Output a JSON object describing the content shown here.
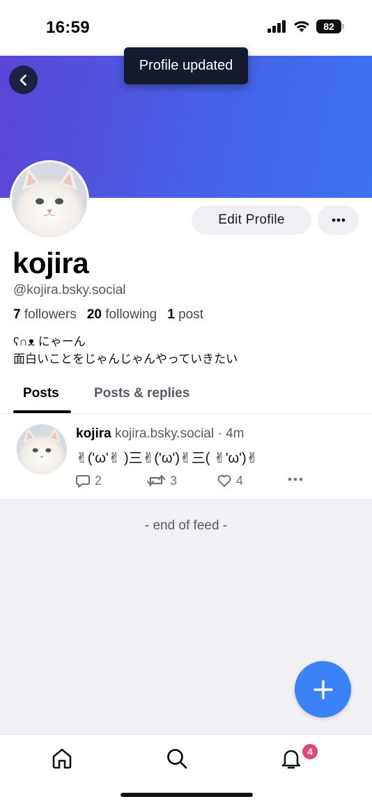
{
  "status_bar": {
    "time": "16:59",
    "battery": "82"
  },
  "toast": {
    "text": "Profile updated"
  },
  "profile": {
    "display_name": "kojira",
    "handle": "@kojira.bsky.social",
    "followers_count": "7",
    "followers_label": "followers",
    "following_count": "20",
    "following_label": "following",
    "posts_count": "1",
    "posts_label": "post",
    "bio_line1": "ʕ∩ᴥ にゃーん",
    "bio_line2": "面白いことをじゃんじゃんやっていきたい",
    "edit_button": "Edit Profile"
  },
  "tabs": [
    {
      "label": "Posts",
      "active": true
    },
    {
      "label": "Posts & replies",
      "active": false
    }
  ],
  "post": {
    "author": "kojira",
    "handle": "kojira.bsky.social",
    "time": "· 4m",
    "text": "✌('ω'✌ )三✌('ω')✌三( ✌'ω')✌",
    "replies": "2",
    "reposts": "3",
    "likes": "4"
  },
  "feed": {
    "end_text": "- end of feed -"
  },
  "bottom_nav": {
    "notifications_badge": "4"
  },
  "colors": {
    "accent": "#3b82f6",
    "badge": "#e0487a",
    "banner_start": "#5b45d6",
    "banner_end": "#3b73f0"
  }
}
